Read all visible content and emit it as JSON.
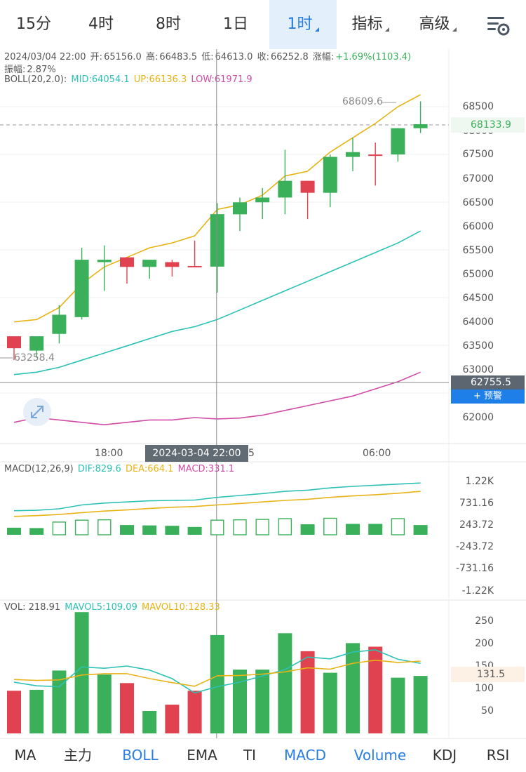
{
  "tabs": [
    {
      "label": "15分",
      "active": false,
      "arrow": false
    },
    {
      "label": "4时",
      "active": false,
      "arrow": false
    },
    {
      "label": "8时",
      "active": false,
      "arrow": false
    },
    {
      "label": "1日",
      "active": false,
      "arrow": false
    },
    {
      "label": "1时",
      "active": true,
      "arrow": true
    },
    {
      "label": "指标",
      "active": false,
      "arrow": true
    },
    {
      "label": "高级",
      "active": false,
      "arrow": true
    }
  ],
  "settings_icon": "chart-settings-icon",
  "ohlc": {
    "datetime": "2024/03/04 22:00",
    "open_label": "开:",
    "open": "65156.0",
    "high_label": "高:",
    "high": "66483.5",
    "low_label": "低:",
    "low": "64613.0",
    "close_label": "收:",
    "close": "66252.8",
    "change_label": "涨幅:",
    "change": "+1.69%(1103.4)",
    "amplitude_label": "振幅:",
    "amplitude": "2.87%"
  },
  "boll": {
    "label": "BOLL(20,2.0):",
    "mid": "MID:64054.1",
    "up": "UP:66136.3",
    "low": "LOW:61971.9"
  },
  "price_axis": [
    "68500",
    "68000",
    "67500",
    "67000",
    "66500",
    "66000",
    "65500",
    "65000",
    "64500",
    "64000",
    "63500",
    "63000",
    "62000"
  ],
  "current_price": "68133.9",
  "crosshair_price": "62755.5",
  "alert_button": "+ 预警",
  "max_marker": "68609.6",
  "min_marker": "63258.4",
  "time_axis": {
    "t1": "18:00",
    "t2": "06:00",
    "crosshair": "2024-03-04 22:00",
    "partial": "5"
  },
  "macd": {
    "label": "MACD(12,26,9)",
    "dif": "DIF:829.6",
    "dea": "DEA:664.1",
    "macd": "MACD:331.1",
    "axis": [
      "1.22K",
      "731.16",
      "243.72",
      "-243.72",
      "-731.16",
      "-1.22K"
    ]
  },
  "vol": {
    "label": "VOL: 218.91",
    "mavol5": "MAVOL5:109.09",
    "mavol10": "MAVOL10:128.33",
    "axis": [
      "250",
      "200",
      "150",
      "100",
      "50"
    ],
    "crosshair_value": "131.5"
  },
  "indicators": [
    {
      "label": "MA",
      "active": false
    },
    {
      "label": "主力",
      "active": false
    },
    {
      "label": "BOLL",
      "active": true
    },
    {
      "label": "EMA",
      "active": false
    },
    {
      "label": "TI",
      "active": false
    },
    {
      "label": "MACD",
      "active": true
    },
    {
      "label": "Volume",
      "active": true
    },
    {
      "label": "KDJ",
      "active": false
    },
    {
      "label": "RSI",
      "active": false
    }
  ],
  "colors": {
    "up": "#3bb05a",
    "down": "#e0424f",
    "accent": "#2a7de1",
    "mid": "#2bc1b4",
    "upper": "#e8b317",
    "lower": "#d14aa6"
  },
  "chart_data": {
    "type": "candlestick",
    "interval": "1时",
    "candles": [
      {
        "o": 63450,
        "h": 63600,
        "l": 63200,
        "c": 63700,
        "dir": "down"
      },
      {
        "o": 63400,
        "h": 63600,
        "l": 63250,
        "c": 63700,
        "dir": "up"
      },
      {
        "o": 63750,
        "h": 64350,
        "l": 63550,
        "c": 64150,
        "dir": "up"
      },
      {
        "o": 64100,
        "h": 65550,
        "l": 64050,
        "c": 65300,
        "dir": "up"
      },
      {
        "o": 65250,
        "h": 65600,
        "l": 64650,
        "c": 65300,
        "dir": "up"
      },
      {
        "o": 65350,
        "h": 65350,
        "l": 64800,
        "c": 65150,
        "dir": "down"
      },
      {
        "o": 65150,
        "h": 65300,
        "l": 64900,
        "c": 65300,
        "dir": "up"
      },
      {
        "o": 65250,
        "h": 65300,
        "l": 64950,
        "c": 65150,
        "dir": "down"
      },
      {
        "o": 65150,
        "h": 65700,
        "l": 65150,
        "c": 65170,
        "dir": "down"
      },
      {
        "o": 65156,
        "h": 66483.5,
        "l": 64613,
        "c": 66252.8,
        "dir": "up"
      },
      {
        "o": 66250,
        "h": 66600,
        "l": 65900,
        "c": 66500,
        "dir": "up"
      },
      {
        "o": 66500,
        "h": 66800,
        "l": 66150,
        "c": 66600,
        "dir": "up"
      },
      {
        "o": 66600,
        "h": 67600,
        "l": 66250,
        "c": 66950,
        "dir": "up"
      },
      {
        "o": 66950,
        "h": 66950,
        "l": 66150,
        "c": 66700,
        "dir": "down"
      },
      {
        "o": 66700,
        "h": 67500,
        "l": 66400,
        "c": 67450,
        "dir": "up"
      },
      {
        "o": 67450,
        "h": 67850,
        "l": 67150,
        "c": 67550,
        "dir": "up"
      },
      {
        "o": 67500,
        "h": 67750,
        "l": 66850,
        "c": 67500,
        "dir": "down"
      },
      {
        "o": 67500,
        "h": 68050,
        "l": 67350,
        "c": 68050,
        "dir": "up"
      },
      {
        "o": 68050,
        "h": 68609.6,
        "l": 67950,
        "c": 68133.9,
        "dir": "up"
      }
    ],
    "boll_up": [
      64000,
      64050,
      64300,
      64800,
      65150,
      65350,
      65550,
      65650,
      65800,
      66350,
      66450,
      66650,
      67050,
      67150,
      67550,
      67850,
      68150,
      68500,
      68750
    ],
    "boll_mid": [
      62900,
      62950,
      63050,
      63200,
      63350,
      63500,
      63650,
      63800,
      63900,
      64050,
      64250,
      64450,
      64650,
      64850,
      65050,
      65250,
      65450,
      65650,
      65900
    ],
    "boll_low": [
      61900,
      62000,
      61950,
      61900,
      61850,
      61900,
      61950,
      61950,
      62000,
      61972,
      61990,
      62050,
      62150,
      62250,
      62350,
      62450,
      62600,
      62750,
      62950
    ],
    "macd_dif": [
      450,
      460,
      500,
      600,
      650,
      680,
      710,
      720,
      730,
      800,
      850,
      900,
      960,
      990,
      1050,
      1090,
      1120,
      1150,
      1180
    ],
    "macd_dea": [
      300,
      320,
      350,
      400,
      440,
      470,
      510,
      540,
      560,
      600,
      640,
      680,
      720,
      750,
      800,
      840,
      870,
      910,
      960
    ],
    "macd_hist": [
      150,
      140,
      150,
      200,
      210,
      220,
      210,
      200,
      170,
      200,
      210,
      220,
      240,
      240,
      250,
      250,
      250,
      240,
      220
    ],
    "macd_hist_hollow": [
      false,
      false,
      true,
      true,
      true,
      false,
      false,
      false,
      false,
      true,
      true,
      true,
      true,
      false,
      true,
      false,
      false,
      true,
      false
    ],
    "volume": [
      95,
      97,
      140,
      270,
      131,
      112,
      50,
      64,
      95,
      218.91,
      142,
      142,
      223,
      183,
      135,
      201,
      193,
      124,
      128
    ],
    "mavol5": [
      114,
      106,
      104,
      148,
      145,
      150,
      141,
      122,
      90,
      104,
      114,
      128,
      142,
      170,
      166,
      181,
      186,
      165,
      156
    ],
    "mavol10": [
      120,
      118,
      119,
      130,
      133,
      133,
      122,
      113,
      105,
      128.33,
      129,
      132,
      137,
      146,
      143,
      156,
      163,
      158,
      161
    ]
  }
}
